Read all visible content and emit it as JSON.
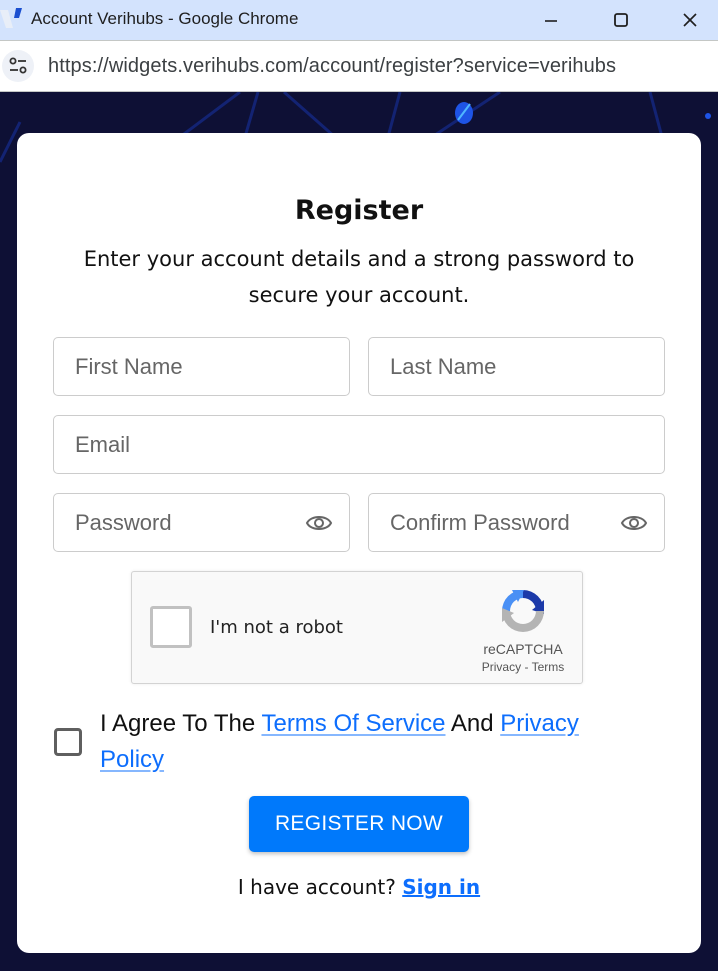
{
  "window": {
    "title": "Account Verihubs - Google Chrome",
    "controls": [
      "minimize",
      "maximize",
      "close"
    ]
  },
  "browser": {
    "url": "https://widgets.verihubs.com/account/register?service=verihubs"
  },
  "form": {
    "heading": "Register",
    "subtitle": "Enter your account details and a strong password to secure your account.",
    "fields": {
      "first_name": {
        "placeholder": "First Name",
        "value": ""
      },
      "last_name": {
        "placeholder": "Last Name",
        "value": ""
      },
      "email": {
        "placeholder": "Email",
        "value": ""
      },
      "password": {
        "placeholder": "Password",
        "value": ""
      },
      "confirm_password": {
        "placeholder": "Confirm Password",
        "value": ""
      }
    },
    "recaptcha": {
      "label": "I'm not a robot",
      "brand": "reCAPTCHA",
      "privacy": "Privacy",
      "separator": " - ",
      "terms": "Terms",
      "checked": false
    },
    "agreement": {
      "prefix": "I Agree To The ",
      "terms_link": "Terms Of Service",
      "middle": " And ",
      "privacy_link": "Privacy Policy",
      "checked": false
    },
    "register_button": "REGISTER NOW",
    "signin": {
      "prompt": "I have account? ",
      "link": "Sign in"
    }
  },
  "colors": {
    "accent": "#0079fb",
    "link": "#0d6efd",
    "background": "#0e1035",
    "titlebar": "#d3e3fd"
  }
}
